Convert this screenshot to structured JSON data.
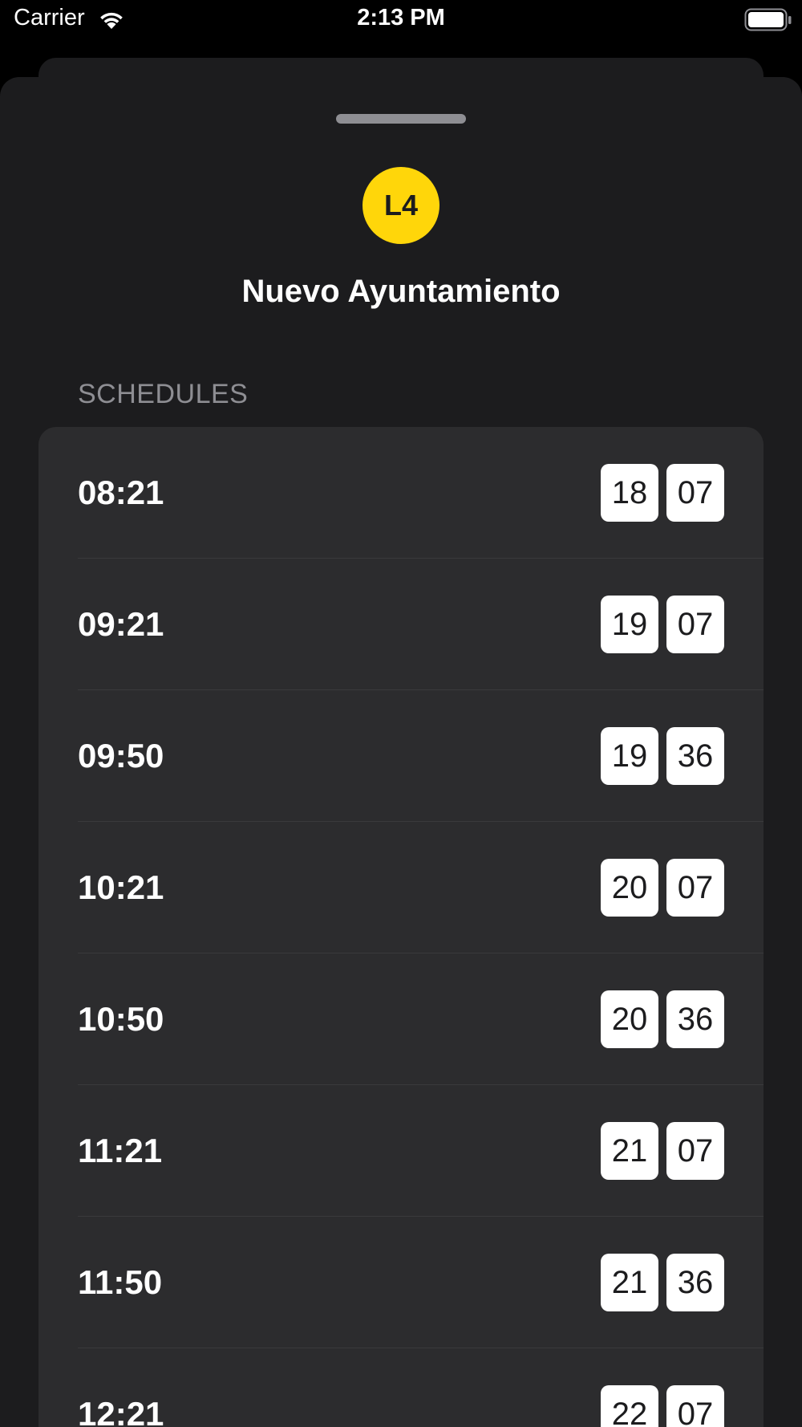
{
  "status_bar": {
    "carrier": "Carrier",
    "time": "2:13 PM"
  },
  "sheet": {
    "line_badge": "L4",
    "line_color": "#ffd60a",
    "station_name": "Nuevo Ayuntamiento",
    "section_header": "SCHEDULES"
  },
  "schedules": [
    {
      "time": "08:21",
      "chip_1": "18",
      "chip_2": "07"
    },
    {
      "time": "09:21",
      "chip_1": "19",
      "chip_2": "07"
    },
    {
      "time": "09:50",
      "chip_1": "19",
      "chip_2": "36"
    },
    {
      "time": "10:21",
      "chip_1": "20",
      "chip_2": "07"
    },
    {
      "time": "10:50",
      "chip_1": "20",
      "chip_2": "36"
    },
    {
      "time": "11:21",
      "chip_1": "21",
      "chip_2": "07"
    },
    {
      "time": "11:50",
      "chip_1": "21",
      "chip_2": "36"
    },
    {
      "time": "12:21",
      "chip_1": "22",
      "chip_2": "07"
    }
  ],
  "icons": {
    "wifi": "wifi-icon",
    "battery": "battery-icon"
  },
  "colors": {
    "background": "#000000",
    "sheet": "#1c1c1e",
    "list": "#2c2c2e",
    "secondary_text": "#8e8e93"
  }
}
